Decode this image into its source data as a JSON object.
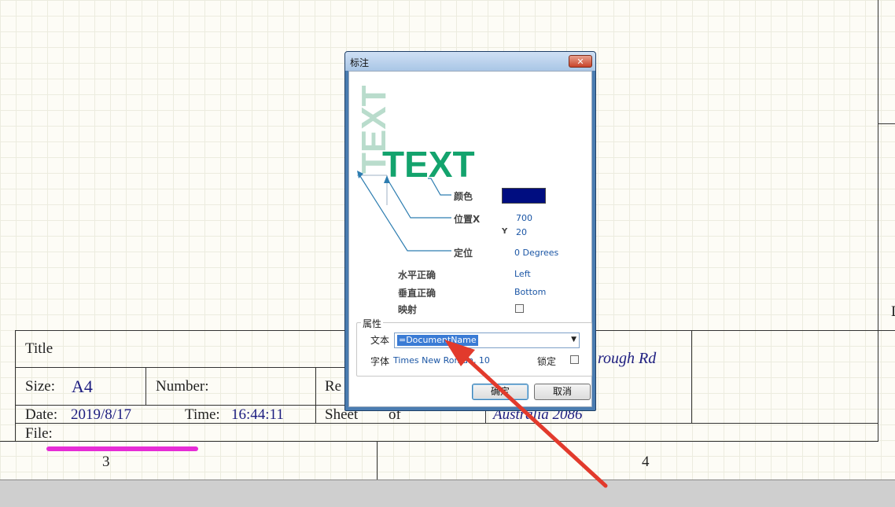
{
  "title_block": {
    "title_label": "Title",
    "size_label": "Size:",
    "size_value": "A4",
    "number_label": "Number:",
    "revision_label": "Re",
    "date_label": "Date:",
    "date_value": "2019/8/17",
    "time_label": "Time:",
    "time_value": "16:44:11",
    "sheet_label": "Sheet",
    "of_label": "of",
    "file_label": "File:",
    "address_line1": "rough Rd",
    "address_line2": "Australia 2086",
    "zone_left": "3",
    "zone_right": "4",
    "edge_letter": "D"
  },
  "dialog": {
    "title": "标注",
    "close_glyph": "✕",
    "preview": {
      "vertical_text": "TEXT",
      "horizontal_text": "TEXT",
      "color_label": "颜色",
      "color_value": "#000d80",
      "position_x_label": "位置X",
      "position_x_value": "700",
      "position_y_label": "Y",
      "position_y_value": "20",
      "orientation_label": "定位",
      "orientation_value": "0 Degrees"
    },
    "horizontal_justify_label": "水平正确",
    "horizontal_justify_value": "Left",
    "vertical_justify_label": "垂直正确",
    "vertical_justify_value": "Bottom",
    "mirror_label": "映射",
    "properties": {
      "group_title": "属性",
      "text_label": "文本",
      "text_value": "=DocumentName",
      "font_label": "字体",
      "font_value": "Times New Roman, 10",
      "lock_label": "锁定"
    },
    "ok_label": "确定",
    "cancel_label": "取消"
  },
  "colors": {
    "preview_vertical": "#b9dccc",
    "preview_horizontal": "#13a36d",
    "leader": "#2d7db0",
    "annotation_arrow": "#e23a2c",
    "highlight": "#e62cd6"
  }
}
